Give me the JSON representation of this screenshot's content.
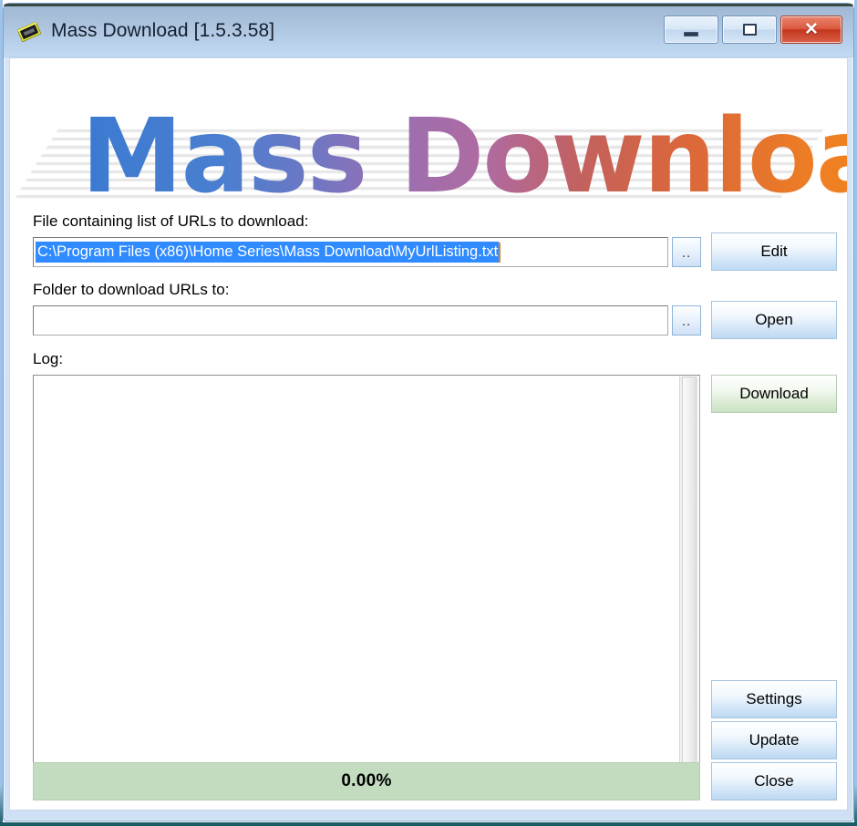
{
  "window": {
    "title": "Mass Download [1.5.3.58]",
    "icon": "app-icon",
    "controls": {
      "minimize": "minimize-icon",
      "maximize": "maximize-icon",
      "close": "✕"
    }
  },
  "logo": {
    "text": "Mass Download",
    "gradient_start": "#3b7ad1",
    "gradient_mid": "#b06a9e",
    "gradient_end": "#f08522"
  },
  "fields": {
    "url_file": {
      "label": "File containing list of URLs to download:",
      "value": "C:\\Program Files (x86)\\Home Series\\Mass Download\\MyUrlListing.txt",
      "placeholder": "",
      "browse_label": "..",
      "selected": true
    },
    "download_folder": {
      "label": "Folder to download URLs to:",
      "value": "",
      "placeholder": "",
      "browse_label": ".."
    },
    "log": {
      "label": "Log:",
      "value": ""
    }
  },
  "buttons": {
    "edit": "Edit",
    "open": "Open",
    "download": "Download",
    "settings": "Settings",
    "update": "Update",
    "close": "Close"
  },
  "progress": {
    "percent_label": "0.00%",
    "value": 0,
    "track_color": "#c3dcc0"
  },
  "colors": {
    "accent_blue": "#2f8bff",
    "download_green": "#c9e2c2",
    "titlebar": "#b4cbe6",
    "close_red": "#c4381f"
  }
}
